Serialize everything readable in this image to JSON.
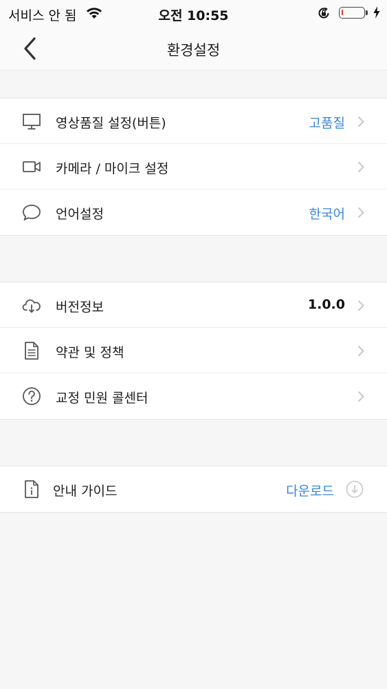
{
  "status_bar": {
    "carrier": "서비스 안 됨",
    "time": "오전 10:55",
    "battery_level": 0.08
  },
  "nav": {
    "title": "환경설정"
  },
  "groups": [
    {
      "items": [
        {
          "label": "영상품질 설정(버튼)",
          "value": "고품질",
          "icon": "monitor-icon"
        },
        {
          "label": "카메라 / 마이크 설정",
          "value": "",
          "icon": "video-camera-icon"
        },
        {
          "label": "언어설정",
          "value": "한국어",
          "icon": "chat-bubble-icon"
        }
      ]
    },
    {
      "items": [
        {
          "label": "버전정보",
          "value": "1.0.0",
          "icon": "cloud-download-icon"
        },
        {
          "label": "약관 및 정책",
          "value": "",
          "icon": "document-icon"
        },
        {
          "label": "교정 민원 콜센터",
          "value": "",
          "icon": "question-circle-icon"
        }
      ]
    },
    {
      "items": [
        {
          "label": "안내 가이드",
          "value": "다운로드",
          "icon": "info-document-icon"
        }
      ]
    }
  ],
  "colors": {
    "accent": "#3a86d8",
    "background": "#f6f6f7",
    "row_background": "#ffffff",
    "battery_low": "#e0342b"
  }
}
